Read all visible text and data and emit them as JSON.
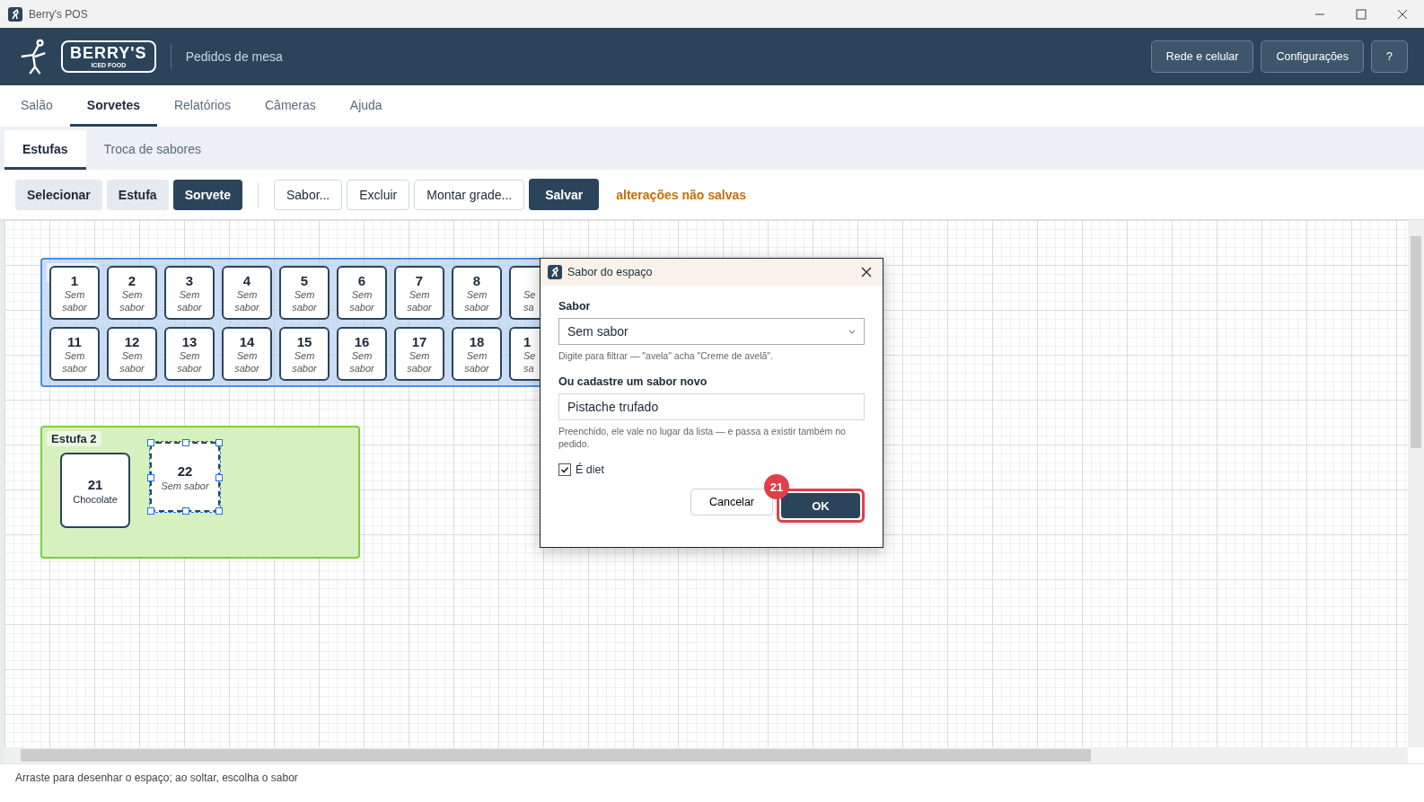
{
  "window": {
    "title": "Berry's POS"
  },
  "header": {
    "logo_text": "BERRY'S",
    "logo_subtext": "ICED FOOD",
    "section": "Pedidos de mesa",
    "buttons": [
      "Rede e celular",
      "Configurações",
      "?"
    ]
  },
  "main_tabs": [
    {
      "label": "Salão",
      "selected": false
    },
    {
      "label": "Sorvetes",
      "selected": true
    },
    {
      "label": "Relatórios",
      "selected": false
    },
    {
      "label": "Câmeras",
      "selected": false
    },
    {
      "label": "Ajuda",
      "selected": false
    }
  ],
  "sub_tabs": [
    {
      "label": "Estufas",
      "selected": true
    },
    {
      "label": "Troca de sabores",
      "selected": false
    }
  ],
  "toolbar": {
    "mode_buttons": [
      {
        "label": "Selecionar",
        "selected": false
      },
      {
        "label": "Estufa",
        "selected": false
      },
      {
        "label": "Sorvete",
        "selected": true
      }
    ],
    "actions": [
      "Sabor...",
      "Excluir",
      "Montar grade..."
    ],
    "save_button": "Salvar",
    "unsaved_notice": "alterações não salvas"
  },
  "canvas": {
    "groups": [
      {
        "kind": "grid",
        "rows": [
          [
            {
              "kind": "full",
              "number": "1",
              "flavor": "Sem sabor",
              "assigned": false,
              "selected": false
            },
            {
              "kind": "full",
              "number": "2",
              "flavor": "Sem sabor",
              "assigned": false,
              "selected": false
            },
            {
              "kind": "full",
              "number": "3",
              "flavor": "Sem sabor",
              "assigned": false,
              "selected": false
            },
            {
              "kind": "full",
              "number": "4",
              "flavor": "Sem sabor",
              "assigned": false,
              "selected": false
            },
            {
              "kind": "full",
              "number": "5",
              "flavor": "Sem sabor",
              "assigned": false,
              "selected": false
            },
            {
              "kind": "full",
              "number": "6",
              "flavor": "Sem sabor",
              "assigned": false,
              "selected": false
            },
            {
              "kind": "full",
              "number": "7",
              "flavor": "Sem sabor",
              "assigned": false,
              "selected": false
            },
            {
              "kind": "full",
              "number": "8",
              "flavor": "Sem sabor",
              "assigned": false,
              "selected": false
            },
            {
              "kind": "partial",
              "lines": [
                "Se",
                "sa"
              ]
            }
          ],
          [
            {
              "kind": "full",
              "number": "11",
              "flavor": "Sem sabor",
              "assigned": false,
              "selected": false
            },
            {
              "kind": "full",
              "number": "12",
              "flavor": "Sem sabor",
              "assigned": false,
              "selected": false
            },
            {
              "kind": "full",
              "number": "13",
              "flavor": "Sem sabor",
              "assigned": false,
              "selected": false
            },
            {
              "kind": "full",
              "number": "14",
              "flavor": "Sem sabor",
              "assigned": false,
              "selected": false
            },
            {
              "kind": "full",
              "number": "15",
              "flavor": "Sem sabor",
              "assigned": false,
              "selected": false
            },
            {
              "kind": "full",
              "number": "16",
              "flavor": "Sem sabor",
              "assigned": false,
              "selected": false
            },
            {
              "kind": "full",
              "number": "17",
              "flavor": "Sem sabor",
              "assigned": false,
              "selected": false
            },
            {
              "kind": "full",
              "number": "18",
              "flavor": "Sem sabor",
              "assigned": false,
              "selected": false
            },
            {
              "kind": "partial",
              "number": "1",
              "lines": [
                "Se",
                "sa"
              ]
            }
          ]
        ]
      },
      {
        "kind": "free",
        "label": "Estufa 2",
        "tiles": [
          {
            "number": "21",
            "flavor": "Chocolate",
            "assigned": true,
            "selected": false
          },
          {
            "number": "22",
            "flavor": "Sem sabor",
            "assigned": false,
            "selected": true
          }
        ]
      }
    ]
  },
  "dialog": {
    "title": "Sabor do espaço",
    "flavor_label": "Sabor",
    "flavor_value": "Sem sabor",
    "flavor_hint": "Digite para filtrar — \"avela\" acha \"Creme de avelã\".",
    "new_label": "Ou cadastre um sabor novo",
    "new_value": "Pistache trufado",
    "new_hint": "Preenchido, ele vale no lugar da lista — e passa a existir também no pedido.",
    "diet": {
      "label": "É diet",
      "checked": true
    },
    "cancel": "Cancelar",
    "ok": "OK",
    "ok_badge": "21"
  },
  "status_bar": "Arraste para desenhar o espaço; ao soltar, escolha o sabor"
}
